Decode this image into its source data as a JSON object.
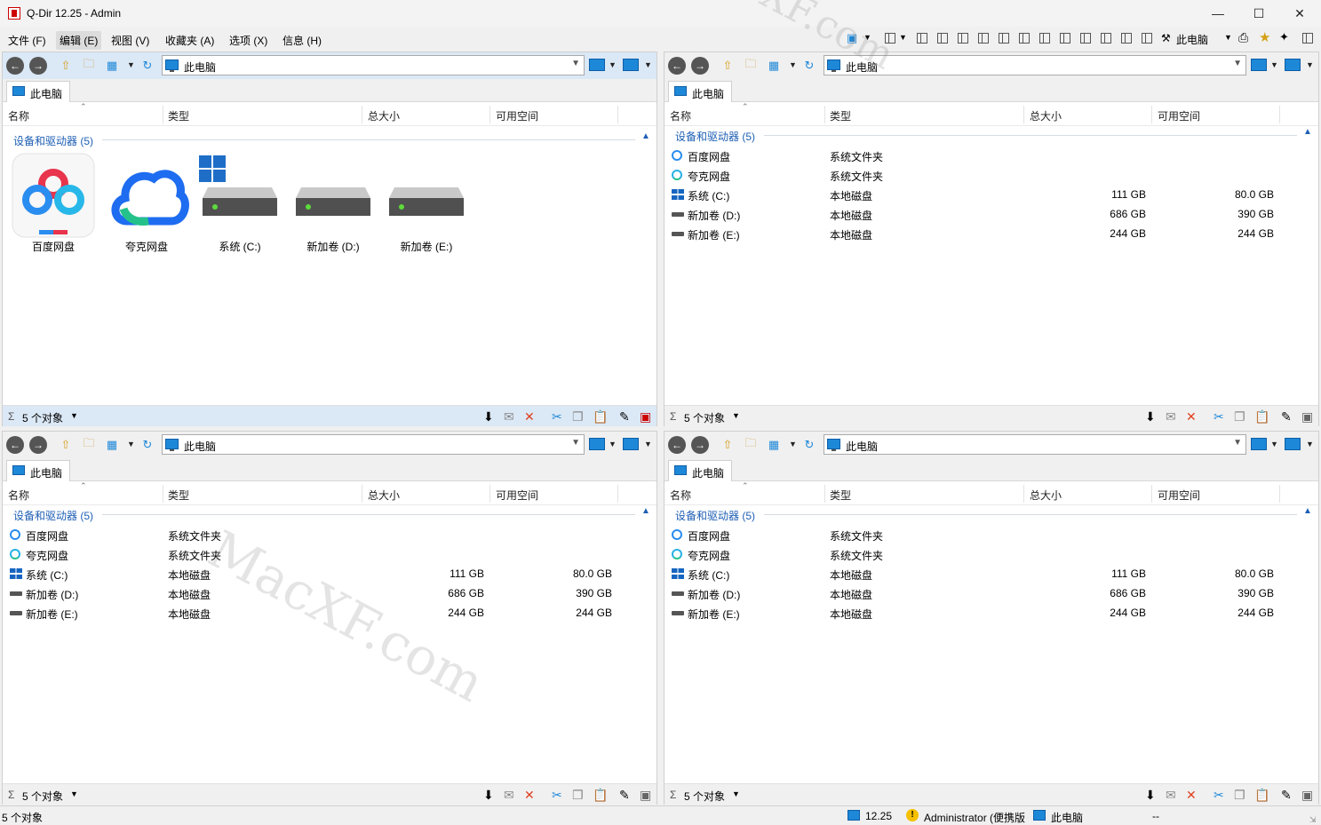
{
  "window": {
    "title": "Q-Dir 12.25 - Admin",
    "minimize": "—",
    "maximize": "☐",
    "close": "✕"
  },
  "menu": [
    {
      "label": "文件 (F)"
    },
    {
      "label": "编辑 (E)"
    },
    {
      "label": "视图 (V)"
    },
    {
      "label": "收藏夹 (A)"
    },
    {
      "label": "选项 (X)"
    },
    {
      "label": "信息 (H)"
    }
  ],
  "top_toolbar": {
    "location_label": "此电脑"
  },
  "columns": [
    "名称",
    "类型",
    "总大小",
    "可用空间"
  ],
  "panes": [
    {
      "address": "此电脑",
      "tab": "此电脑",
      "group": "设备和驱动器 (5)",
      "view": "icons",
      "status": "5 个对象",
      "items": [
        {
          "name": "百度网盘",
          "icon": "baidu-icon"
        },
        {
          "name": "夸克网盘",
          "icon": "kuake-icon"
        },
        {
          "name": "系统 (C:)",
          "icon": "windows-drive-icon"
        },
        {
          "name": "新加卷 (D:)",
          "icon": "drive-icon"
        },
        {
          "name": "新加卷 (E:)",
          "icon": "drive-icon"
        }
      ]
    },
    {
      "address": "此电脑",
      "tab": "此电脑",
      "group": "设备和驱动器 (5)",
      "view": "details",
      "status": "5 个对象",
      "rows": [
        {
          "name": "百度网盘",
          "type": "系统文件夹",
          "total": "",
          "free": "",
          "icon": "baidu-icon"
        },
        {
          "name": "夸克网盘",
          "type": "系统文件夹",
          "total": "",
          "free": "",
          "icon": "kuake-icon"
        },
        {
          "name": "系统 (C:)",
          "type": "本地磁盘",
          "total": "111 GB",
          "free": "80.0 GB",
          "icon": "windows-drive-icon"
        },
        {
          "name": "新加卷 (D:)",
          "type": "本地磁盘",
          "total": "686 GB",
          "free": "390 GB",
          "icon": "drive-icon"
        },
        {
          "name": "新加卷 (E:)",
          "type": "本地磁盘",
          "total": "244 GB",
          "free": "244 GB",
          "icon": "drive-icon"
        }
      ]
    },
    {
      "address": "此电脑",
      "tab": "此电脑",
      "group": "设备和驱动器 (5)",
      "view": "details",
      "status": "5 个对象",
      "rows": [
        {
          "name": "百度网盘",
          "type": "系统文件夹",
          "total": "",
          "free": "",
          "icon": "baidu-icon"
        },
        {
          "name": "夸克网盘",
          "type": "系统文件夹",
          "total": "",
          "free": "",
          "icon": "kuake-icon"
        },
        {
          "name": "系统 (C:)",
          "type": "本地磁盘",
          "total": "111 GB",
          "free": "80.0 GB",
          "icon": "windows-drive-icon"
        },
        {
          "name": "新加卷 (D:)",
          "type": "本地磁盘",
          "total": "686 GB",
          "free": "390 GB",
          "icon": "drive-icon"
        },
        {
          "name": "新加卷 (E:)",
          "type": "本地磁盘",
          "total": "244 GB",
          "free": "244 GB",
          "icon": "drive-icon"
        }
      ]
    },
    {
      "address": "此电脑",
      "tab": "此电脑",
      "group": "设备和驱动器 (5)",
      "view": "details",
      "status": "5 个对象",
      "rows": [
        {
          "name": "百度网盘",
          "type": "系统文件夹",
          "total": "",
          "free": "",
          "icon": "baidu-icon"
        },
        {
          "name": "夸克网盘",
          "type": "系统文件夹",
          "total": "",
          "free": "",
          "icon": "kuake-icon"
        },
        {
          "name": "系统 (C:)",
          "type": "本地磁盘",
          "total": "111 GB",
          "free": "80.0 GB",
          "icon": "windows-drive-icon"
        },
        {
          "name": "新加卷 (D:)",
          "type": "本地磁盘",
          "total": "686 GB",
          "free": "390 GB",
          "icon": "drive-icon"
        },
        {
          "name": "新加卷 (E:)",
          "type": "本地磁盘",
          "total": "244 GB",
          "free": "244 GB",
          "icon": "drive-icon"
        }
      ]
    }
  ],
  "bottom_status": {
    "objects": "5 个对象",
    "version": "12.25",
    "user": "Administrator (便携版",
    "location": "此电脑",
    "extra": "--"
  },
  "watermark": {
    "text1": "MacXF.com",
    "text2": "MacXF.com"
  },
  "colors": {
    "accent": "#1e88d8",
    "group_text": "#1e5fb4",
    "active_pane": "#dbe8f6"
  }
}
